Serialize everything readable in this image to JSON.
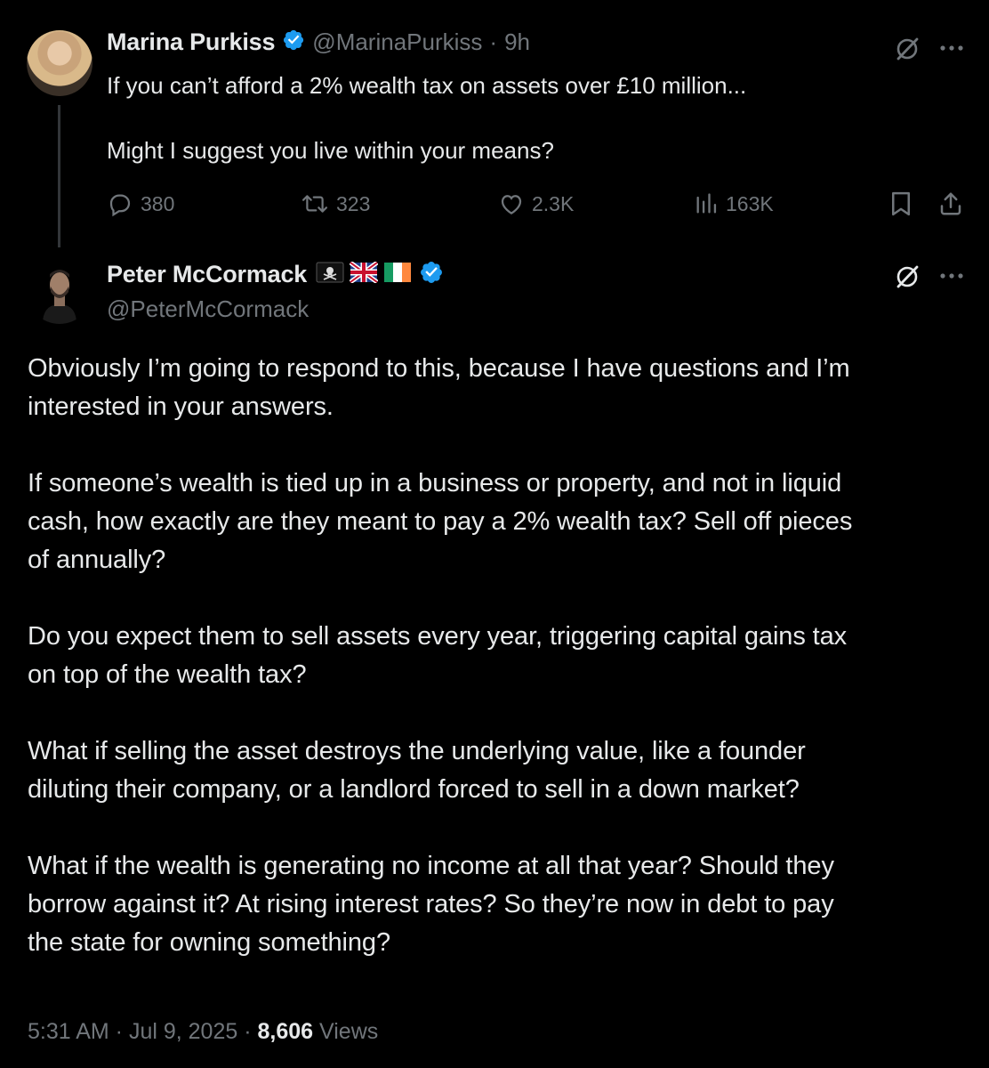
{
  "quoted_tweet": {
    "author_name": "Marina Purkiss",
    "handle": "@MarinaPurkiss",
    "separator": "·",
    "time": "9h",
    "line1": "If you can’t afford a 2% wealth tax on assets over £10 million...",
    "line2": "Might I suggest you live within your means?",
    "replies": "380",
    "reposts": "323",
    "likes": "2.3K",
    "views": "163K",
    "icons": [
      "verified-badge-icon",
      "grok-icon",
      "more-icon",
      "reply-icon",
      "repost-icon",
      "like-icon",
      "views-icon",
      "bookmark-icon",
      "share-icon"
    ]
  },
  "main_tweet": {
    "author_name": "Peter McCormack",
    "name_emojis": [
      "pirate-flag",
      "uk-flag",
      "ireland-flag"
    ],
    "handle": "@PeterMcCormack",
    "paragraphs": [
      [
        "Obviously I’m going to respond to this, because I have questions and I’m",
        "interested in your answers."
      ],
      [
        "If someone’s wealth is tied up in a business or property, and not in liquid",
        "cash, how exactly are they meant to pay a 2% wealth tax? Sell off pieces",
        "of annually?"
      ],
      [
        "Do you expect them to sell assets every year, triggering capital gains tax",
        "on top of the wealth tax?"
      ],
      [
        "What if selling the asset destroys the underlying value, like a founder",
        "diluting their company, or a landlord forced to sell in a down market?"
      ],
      [
        "What if the wealth is generating no income at all that year? Should they",
        "borrow against it? At rising interest rates? So they’re now in debt to pay",
        "the state for owning something?"
      ]
    ],
    "timestamp": "5:31 AM · Jul 9, 2025",
    "dot": "·",
    "views_count": "8,606",
    "views_label": "Views"
  },
  "colors": {
    "background": "#000000",
    "text": "#e7e9ea",
    "muted": "#71767b",
    "verified": "#1d9bf0",
    "thread_line": "#333639"
  }
}
